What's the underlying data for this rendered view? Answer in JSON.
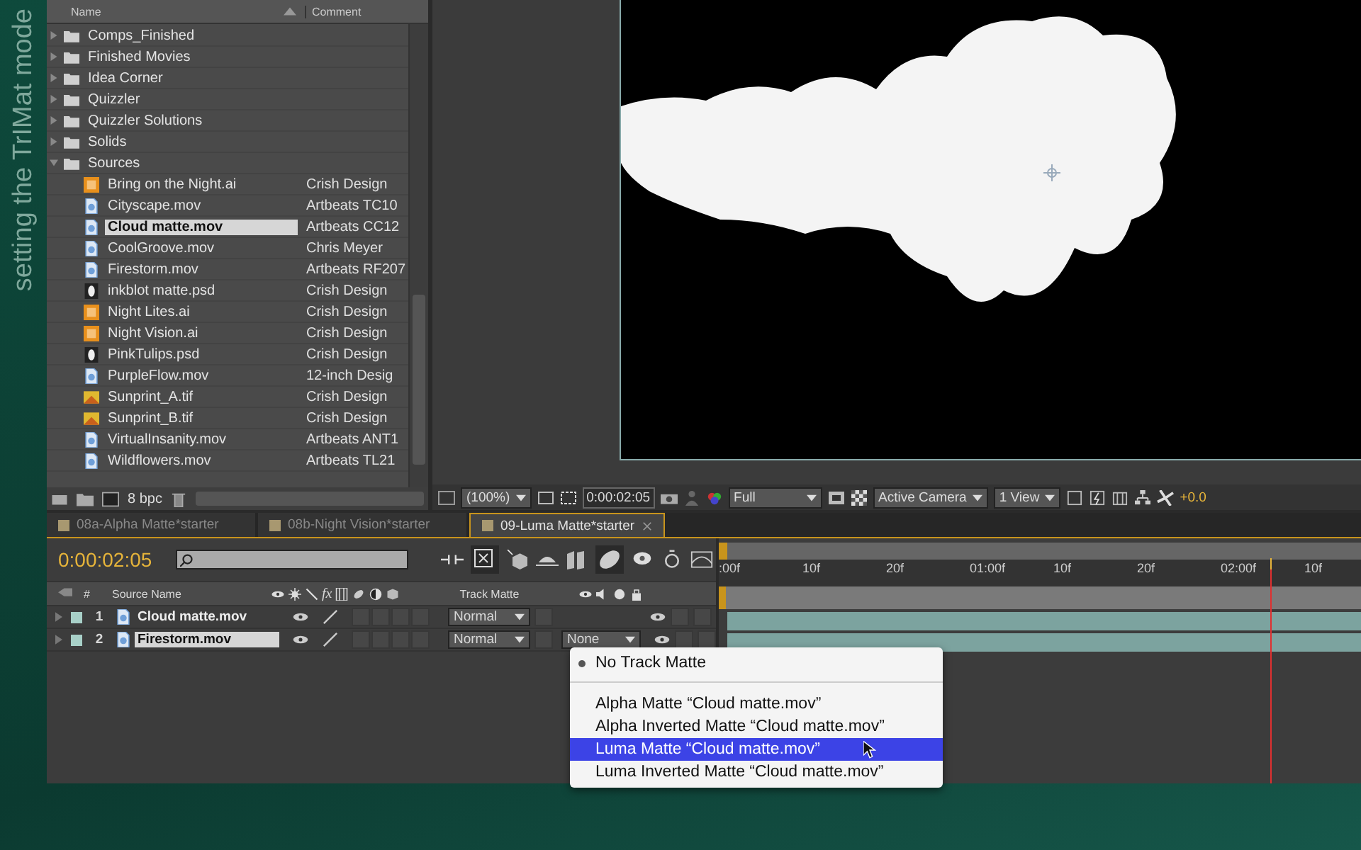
{
  "side_title": "setting the TrIMat mode",
  "project": {
    "columns": [
      "Name",
      "Comment"
    ],
    "items": [
      {
        "kind": "folder",
        "name": "Comps_Finished",
        "expanded": false,
        "selected": false
      },
      {
        "kind": "folder",
        "name": "Finished Movies",
        "expanded": false,
        "selected": false
      },
      {
        "kind": "folder",
        "name": "Idea Corner",
        "expanded": false,
        "selected": false
      },
      {
        "kind": "folder",
        "name": "Quizzler",
        "expanded": false,
        "selected": false
      },
      {
        "kind": "folder",
        "name": "Quizzler Solutions",
        "expanded": false,
        "selected": false
      },
      {
        "kind": "folder",
        "name": "Solids",
        "expanded": false,
        "selected": false
      },
      {
        "kind": "folder",
        "name": "Sources",
        "expanded": true,
        "selected": false,
        "children": [
          {
            "kind": "ai",
            "name": "Bring on the Night.ai",
            "comment": "Crish Design",
            "selected": false
          },
          {
            "kind": "mov",
            "name": "Cityscape.mov",
            "comment": "Artbeats TC10",
            "selected": false
          },
          {
            "kind": "mov",
            "name": "Cloud matte.mov",
            "comment": "Artbeats CC12",
            "selected": true
          },
          {
            "kind": "mov",
            "name": "CoolGroove.mov",
            "comment": "Chris Meyer",
            "selected": false
          },
          {
            "kind": "mov",
            "name": "Firestorm.mov",
            "comment": "Artbeats RF207",
            "selected": false
          },
          {
            "kind": "psd",
            "name": "inkblot matte.psd",
            "comment": "Crish Design",
            "selected": false
          },
          {
            "kind": "ai",
            "name": "Night Lites.ai",
            "comment": "Crish Design",
            "selected": false
          },
          {
            "kind": "ai",
            "name": "Night Vision.ai",
            "comment": "Crish Design",
            "selected": false
          },
          {
            "kind": "psd",
            "name": "PinkTulips.psd",
            "comment": "Crish Design",
            "selected": false
          },
          {
            "kind": "mov",
            "name": "PurpleFlow.mov",
            "comment": "12-inch Desig",
            "selected": false
          },
          {
            "kind": "tif",
            "name": "Sunprint_A.tif",
            "comment": "Crish Design",
            "selected": false
          },
          {
            "kind": "tif",
            "name": "Sunprint_B.tif",
            "comment": "Crish Design",
            "selected": false
          },
          {
            "kind": "mov",
            "name": "VirtualInsanity.mov",
            "comment": "Artbeats ANT1",
            "selected": false
          },
          {
            "kind": "mov",
            "name": "Wildflowers.mov",
            "comment": "Artbeats TL21",
            "selected": false
          }
        ]
      }
    ],
    "bpc": "8 bpc"
  },
  "viewer": {
    "zoom": "(100%)",
    "timecode": "0:00:02:05",
    "resolution": "Full",
    "camera": "Active Camera",
    "views": "1 View",
    "exposure": "+0.0"
  },
  "tabs": [
    {
      "label": "08a-Alpha Matte*starter",
      "selected": false
    },
    {
      "label": "08b-Night Vision*starter",
      "selected": false
    },
    {
      "label": "09-Luma Matte*starter",
      "selected": true
    }
  ],
  "timeline": {
    "timecode": "0:00:02:05",
    "columns": {
      "number": "#",
      "source": "Source Name",
      "fx": "fx",
      "track_matte": "Track Matte"
    },
    "ruler": [
      ":00f",
      "10f",
      "20f",
      "01:00f",
      "10f",
      "20f",
      "02:00f",
      "10f"
    ],
    "layers": [
      {
        "number": "1",
        "name": "Cloud matte.mov",
        "mode": "Normal",
        "selected": false
      },
      {
        "number": "2",
        "name": "Firestorm.mov",
        "mode": "Normal",
        "track_matte": "None",
        "selected": true
      }
    ],
    "menu": [
      {
        "kind": "option",
        "label": "No Track Matte",
        "checked": true,
        "selected": false
      },
      {
        "kind": "separator"
      },
      {
        "kind": "option",
        "label": "Alpha Matte “Cloud matte.mov”",
        "checked": false,
        "selected": false
      },
      {
        "kind": "option",
        "label": "Alpha Inverted Matte “Cloud matte.mov”",
        "checked": false,
        "selected": false
      },
      {
        "kind": "option",
        "label": "Luma Matte “Cloud matte.mov”",
        "checked": false,
        "selected": true
      },
      {
        "kind": "option",
        "label": "Luma Inverted Matte “Cloud matte.mov”",
        "checked": false,
        "selected": false
      }
    ]
  }
}
